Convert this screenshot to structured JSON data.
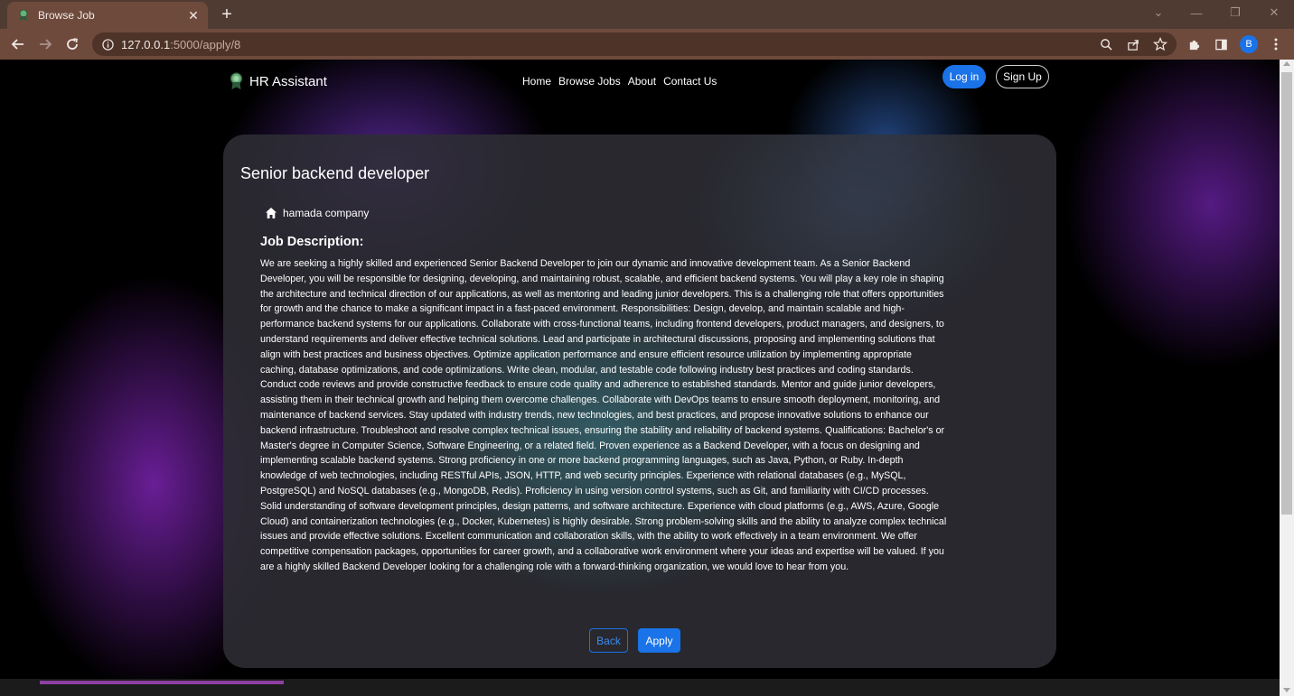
{
  "browser": {
    "tab_title": "Browse Job",
    "url_host": "127.0.0.1",
    "url_path": ":5000/apply/8",
    "profile_initial": "B"
  },
  "site": {
    "brand": "HR Assistant",
    "nav": [
      "Home",
      "Browse Jobs",
      "About",
      "Contact Us"
    ],
    "login_label": "Log in",
    "signup_label": "Sign Up"
  },
  "job": {
    "title": "Senior backend developer",
    "company": "hamada company",
    "description_heading": "Job Description:",
    "description": "We are seeking a highly skilled and experienced Senior Backend Developer to join our dynamic and innovative development team. As a Senior Backend Developer, you will be responsible for designing, developing, and maintaining robust, scalable, and efficient backend systems. You will play a key role in shaping the architecture and technical direction of our applications, as well as mentoring and leading junior developers. This is a challenging role that offers opportunities for growth and the chance to make a significant impact in a fast-paced environment. Responsibilities: Design, develop, and maintain scalable and high-performance backend systems for our applications. Collaborate with cross-functional teams, including frontend developers, product managers, and designers, to understand requirements and deliver effective technical solutions. Lead and participate in architectural discussions, proposing and implementing solutions that align with best practices and business objectives. Optimize application performance and ensure efficient resource utilization by implementing appropriate caching, database optimizations, and code optimizations. Write clean, modular, and testable code following industry best practices and coding standards. Conduct code reviews and provide constructive feedback to ensure code quality and adherence to established standards. Mentor and guide junior developers, assisting them in their technical growth and helping them overcome challenges. Collaborate with DevOps teams to ensure smooth deployment, monitoring, and maintenance of backend services. Stay updated with industry trends, new technologies, and best practices, and propose innovative solutions to enhance our backend infrastructure. Troubleshoot and resolve complex technical issues, ensuring the stability and reliability of backend systems. Qualifications: Bachelor's or Master's degree in Computer Science, Software Engineering, or a related field. Proven experience as a Backend Developer, with a focus on designing and implementing scalable backend systems. Strong proficiency in one or more backend programming languages, such as Java, Python, or Ruby. In-depth knowledge of web technologies, including RESTful APIs, JSON, HTTP, and web security principles. Experience with relational databases (e.g., MySQL, PostgreSQL) and NoSQL databases (e.g., MongoDB, Redis). Proficiency in using version control systems, such as Git, and familiarity with CI/CD processes. Solid understanding of software development principles, design patterns, and software architecture. Experience with cloud platforms (e.g., AWS, Azure, Google Cloud) and containerization technologies (e.g., Docker, Kubernetes) is highly desirable. Strong problem-solving skills and the ability to analyze complex technical issues and provide effective solutions. Excellent communication and collaboration skills, with the ability to work effectively in a team environment. We offer competitive compensation packages, opportunities for career growth, and a collaborative work environment where your ideas and expertise will be valued. If you are a highly skilled Backend Developer looking for a challenging role with a forward-thinking organization, we would love to hear from you.",
    "back_label": "Back",
    "apply_label": "Apply"
  },
  "colors": {
    "primary": "#1a73e8",
    "chrome_tab": "#6e4a3d",
    "chrome_bar": "#4f3b32"
  }
}
